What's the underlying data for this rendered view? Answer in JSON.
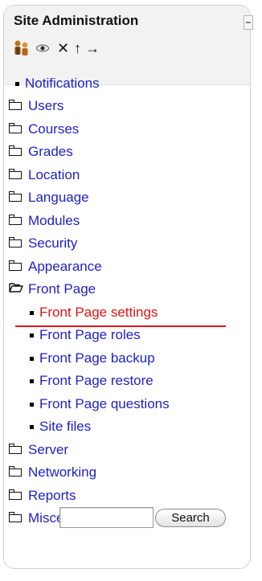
{
  "block": {
    "title": "Site Administration",
    "toolbar_icons": [
      "users-icon",
      "eye-icon",
      "close-icon",
      "arrow-up-icon",
      "arrow-right-icon"
    ]
  },
  "menu": {
    "items": [
      {
        "label": "Notifications",
        "icon": "bullet"
      },
      {
        "label": "Users",
        "icon": "folder-icon"
      },
      {
        "label": "Courses",
        "icon": "folder-icon"
      },
      {
        "label": "Grades",
        "icon": "folder-icon"
      },
      {
        "label": "Location",
        "icon": "folder-icon"
      },
      {
        "label": "Language",
        "icon": "folder-icon"
      },
      {
        "label": "Modules",
        "icon": "folder-icon"
      },
      {
        "label": "Security",
        "icon": "folder-icon"
      },
      {
        "label": "Appearance",
        "icon": "folder-icon"
      },
      {
        "label": "Front Page",
        "icon": "folder-open-icon"
      },
      {
        "label": "Front Page settings",
        "icon": "bullet",
        "active": true
      },
      {
        "label": "Front Page roles",
        "icon": "bullet"
      },
      {
        "label": "Front Page backup",
        "icon": "bullet"
      },
      {
        "label": "Front Page restore",
        "icon": "bullet"
      },
      {
        "label": "Front Page questions",
        "icon": "bullet"
      },
      {
        "label": "Site files",
        "icon": "bullet"
      },
      {
        "label": "Server",
        "icon": "folder-icon"
      },
      {
        "label": "Networking",
        "icon": "folder-icon"
      },
      {
        "label": "Reports",
        "icon": "folder-icon"
      },
      {
        "label": "Miscellaneous",
        "icon": "folder-icon"
      }
    ]
  },
  "search": {
    "value": "",
    "button_label": "Search"
  },
  "colors": {
    "link": "#1f1fc7",
    "active": "#e01414"
  }
}
